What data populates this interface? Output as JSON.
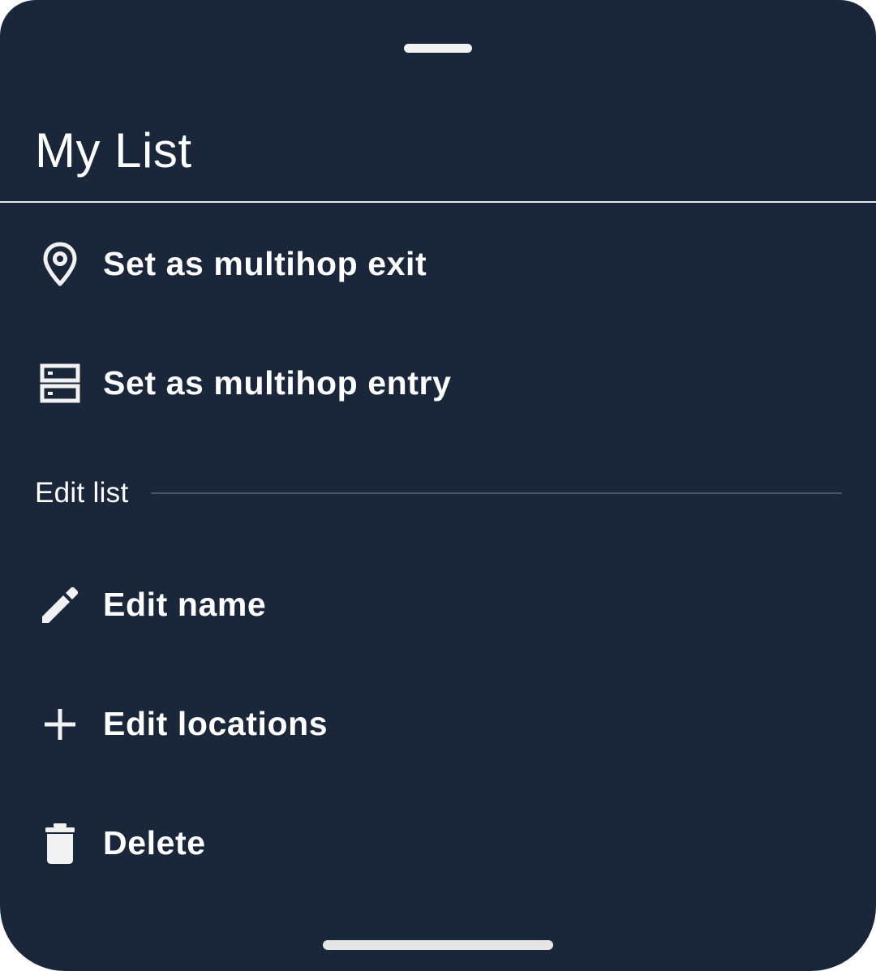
{
  "sheet": {
    "title": "My List",
    "colors": {
      "background": "#1a2639",
      "text": "#ffffff",
      "divider": "#48556a"
    }
  },
  "menu": {
    "items": [
      {
        "label": "Set as multihop exit",
        "icon": "location-pin-icon"
      },
      {
        "label": "Set as multihop entry",
        "icon": "server-icon"
      }
    ]
  },
  "edit_section": {
    "header": "Edit list",
    "items": [
      {
        "label": "Edit name",
        "icon": "pencil-icon"
      },
      {
        "label": "Edit locations",
        "icon": "plus-icon"
      },
      {
        "label": "Delete",
        "icon": "trash-icon"
      }
    ]
  }
}
